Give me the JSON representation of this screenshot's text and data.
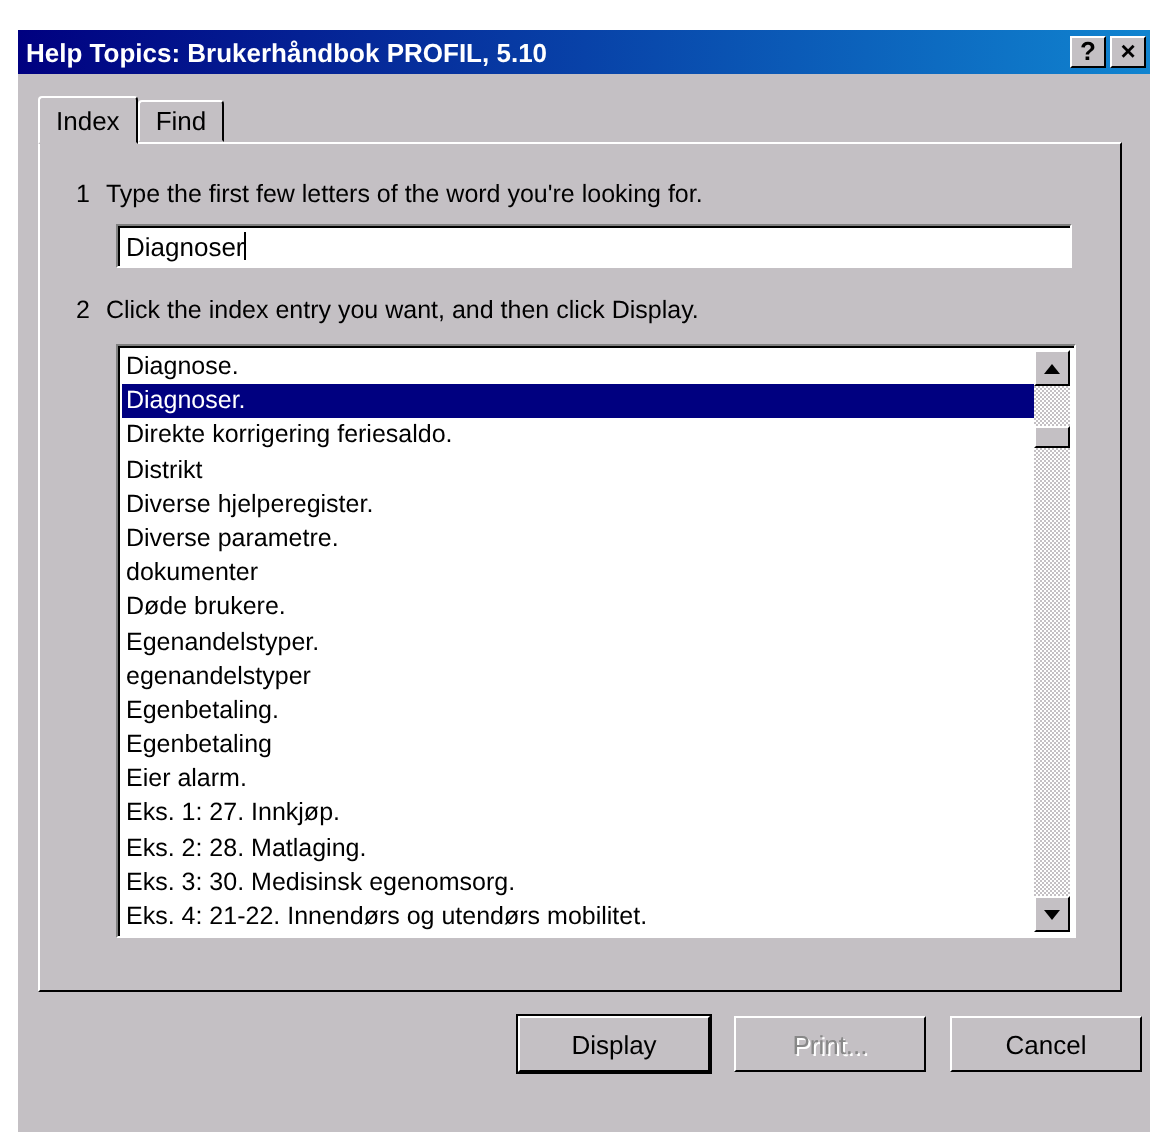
{
  "window": {
    "title": "Help Topics: Brukerhåndbok PROFIL,  5.10",
    "title_buttons": [
      "?",
      "×"
    ]
  },
  "tabs": [
    {
      "label": "Index",
      "selected": true
    },
    {
      "label": "Find",
      "selected": false
    }
  ],
  "step1": {
    "number": "1",
    "text": "Type the first few letters of the word you're looking for."
  },
  "search": {
    "value": "Diagnoser"
  },
  "step2": {
    "number": "2",
    "text": "Click the index entry you want, and then click Display."
  },
  "index_list": [
    {
      "label": "Diagnose.",
      "selected": false
    },
    {
      "label": "Diagnoser.",
      "selected": true
    },
    {
      "label": "Direkte korrigering feriesaldo.",
      "selected": false
    },
    {
      "label": "Distrikt",
      "selected": false
    },
    {
      "label": "Diverse hjelperegister.",
      "selected": false
    },
    {
      "label": "Diverse parametre.",
      "selected": false
    },
    {
      "label": "dokumenter",
      "selected": false
    },
    {
      "label": "Døde brukere.",
      "selected": false
    },
    {
      "label": "Egenandelstyper.",
      "selected": false
    },
    {
      "label": "egenandelstyper",
      "selected": false
    },
    {
      "label": "Egenbetaling.",
      "selected": false
    },
    {
      "label": "Egenbetaling",
      "selected": false
    },
    {
      "label": "Eier alarm.",
      "selected": false
    },
    {
      "label": "Eks. 1: 27. Innkjøp.",
      "selected": false
    },
    {
      "label": "Eks. 2: 28. Matlaging.",
      "selected": false
    },
    {
      "label": "Eks. 3: 30. Medisinsk egenomsorg.",
      "selected": false
    },
    {
      "label": "Eks. 4: 21-22. Innendørs og utendørs mobilitet.",
      "selected": false
    }
  ],
  "buttons": [
    {
      "label": "Display",
      "disabled": false,
      "default": true
    },
    {
      "label": "Print...",
      "disabled": true,
      "default": false
    },
    {
      "label": "Cancel",
      "disabled": false,
      "default": false
    }
  ]
}
